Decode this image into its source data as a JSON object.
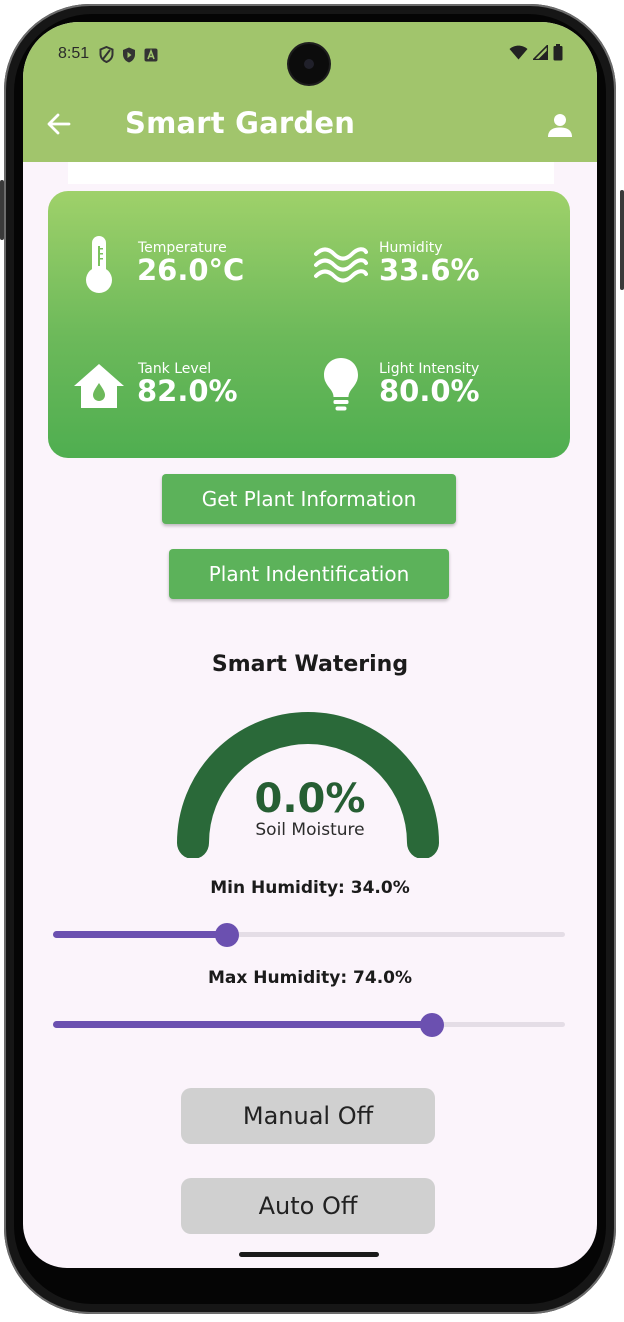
{
  "status_bar": {
    "time": "8:51"
  },
  "app_bar": {
    "title": "Smart Garden"
  },
  "sensors": {
    "temperature": {
      "label": "Temperature",
      "value": "26.0°C"
    },
    "humidity": {
      "label": "Humidity",
      "value": "33.6%"
    },
    "tank_level": {
      "label": "Tank Level",
      "value": "82.0%"
    },
    "light_intensity": {
      "label": "Light Intensity",
      "value": "80.0%"
    }
  },
  "buttons": {
    "get_plant_info": "Get Plant Information",
    "plant_identification": "Plant Indentification",
    "manual": "Manual Off",
    "auto": "Auto Off"
  },
  "smart_watering": {
    "title": "Smart Watering",
    "soil_moisture_value": "0.0%",
    "soil_moisture_label": "Soil Moisture",
    "min_humidity_label": "Min Humidity: 34.0%",
    "min_humidity_percent": 34.0,
    "max_humidity_label": "Max Humidity: 74.0%",
    "max_humidity_percent": 74.0
  },
  "colors": {
    "app_bar": "#a1c56c",
    "card_top": "#9fd16a",
    "card_bottom": "#4fae50",
    "button_green": "#5cb25a",
    "gauge_green": "#2a6939",
    "slider_purple": "#6b50b0",
    "toggle_gray": "#d0d0d0",
    "background": "#fbf4fb"
  },
  "icons": {
    "back": "arrow-left-icon",
    "account": "person-icon",
    "temperature": "thermometer-icon",
    "humidity": "waves-icon",
    "tank": "water-house-icon",
    "light": "lightbulb-icon"
  }
}
